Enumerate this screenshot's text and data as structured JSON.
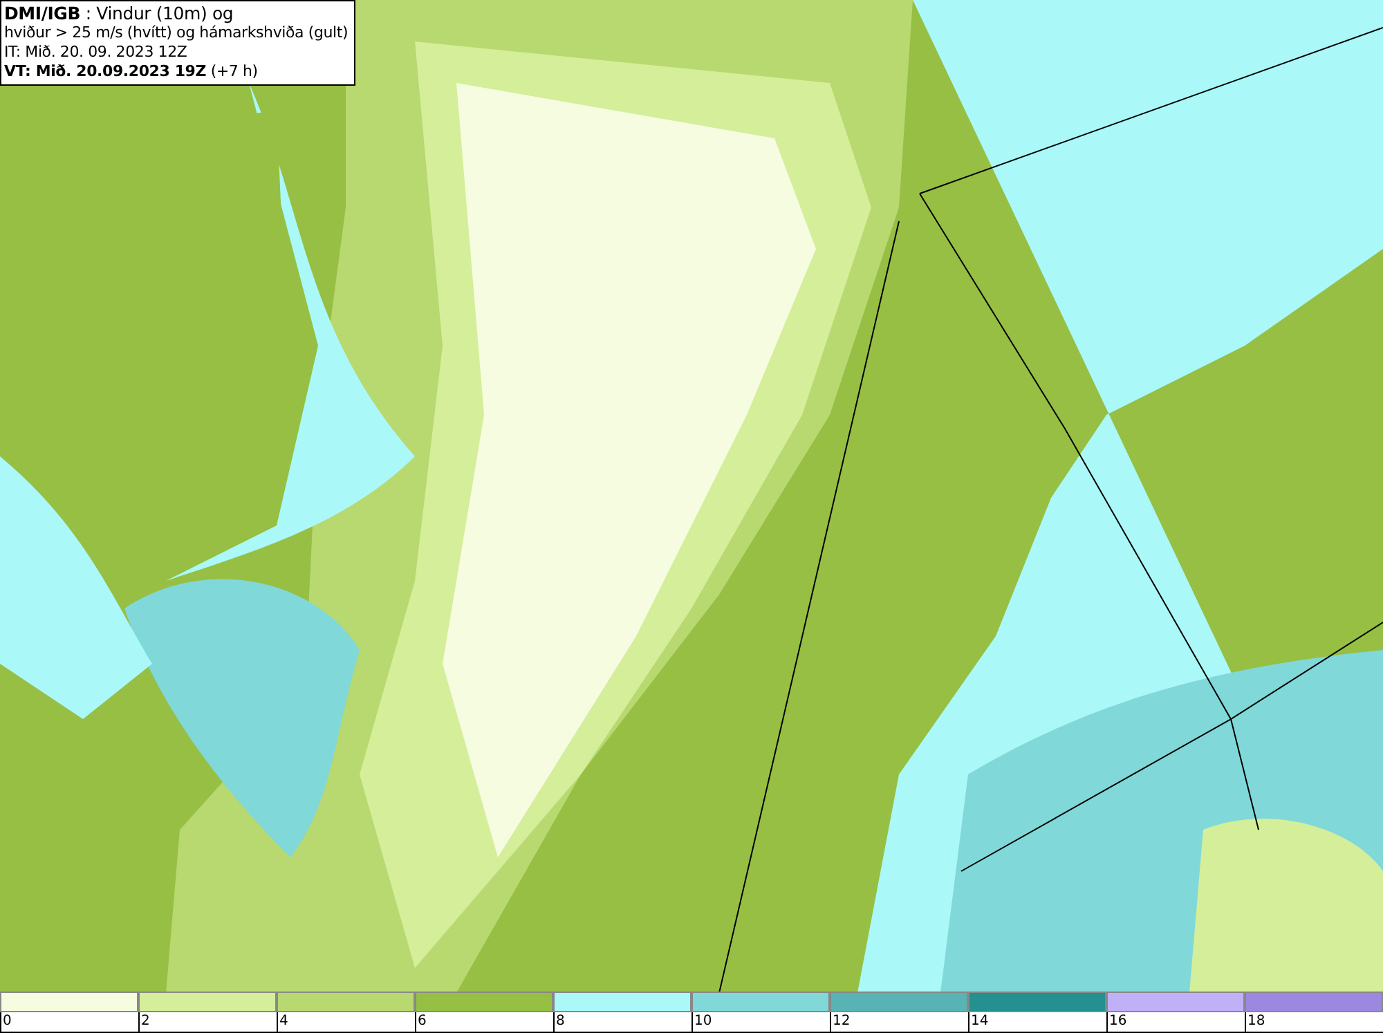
{
  "title_box": {
    "lines": [
      "**DMI/IGB** : Vindur (10m) og",
      "hviður > 25 m/s (hvítt) og hámarkshviða (gult)",
      "IT: Mið. 20. 09. 2023 12Z",
      "**VT: Mið. 20.09.2023 19Z** (+7 h)"
    ]
  },
  "legend": {
    "bins": [
      {
        "color": "#f5fce0"
      },
      {
        "color": "#d4ee9a"
      },
      {
        "color": "#b8d870"
      },
      {
        "color": "#96bf44"
      },
      {
        "color": "#aaf8f8"
      },
      {
        "color": "#80d8d8"
      },
      {
        "color": "#58b4b4"
      },
      {
        "color": "#249090"
      },
      {
        "color": "#c0b0f8"
      },
      {
        "color": "#9c88e0"
      }
    ],
    "labels": [
      "0",
      "2",
      "4",
      "6",
      "8",
      "10",
      "12",
      "14",
      "16",
      "18"
    ]
  }
}
